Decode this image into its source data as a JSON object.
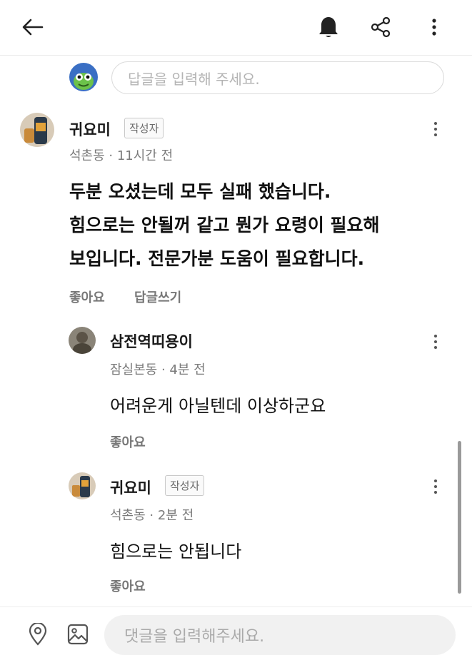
{
  "header": {
    "back_icon": "arrow-left-icon",
    "bell_icon": "bell-icon",
    "share_icon": "share-icon",
    "more_icon": "more-vertical-icon"
  },
  "reply_input": {
    "placeholder": "답글을 입력해 주세요."
  },
  "comments": [
    {
      "author": "귀요미",
      "badge": "작성자",
      "meta": "석촌동 · 11시간 전",
      "lines": [
        "두분 오셨는데 모두 실패 했습니다.",
        "힘으로는 안될꺼 같고 뭔가 요령이 필요해",
        "보입니다. 전문가분 도움이 필요합니다."
      ],
      "like_label": "좋아요",
      "reply_label": "답글쓰기"
    },
    {
      "author": "삼전역띠용이",
      "meta": "잠실본동 · 4분 전",
      "text": "어려운게 아닐텐데 이상하군요",
      "like_label": "좋아요"
    },
    {
      "author": "귀요미",
      "badge": "작성자",
      "meta": "석촌동 · 2분 전",
      "text": "힘으로는 안됩니다",
      "like_label": "좋아요"
    }
  ],
  "bottom": {
    "location_icon": "location-pin-icon",
    "image_icon": "image-icon",
    "placeholder": "댓글을 입력해주세요."
  },
  "colors": {
    "muted_text": "#7a7a7a",
    "input_bg": "#f1f1f1",
    "badge_border": "#c9c9c9"
  }
}
